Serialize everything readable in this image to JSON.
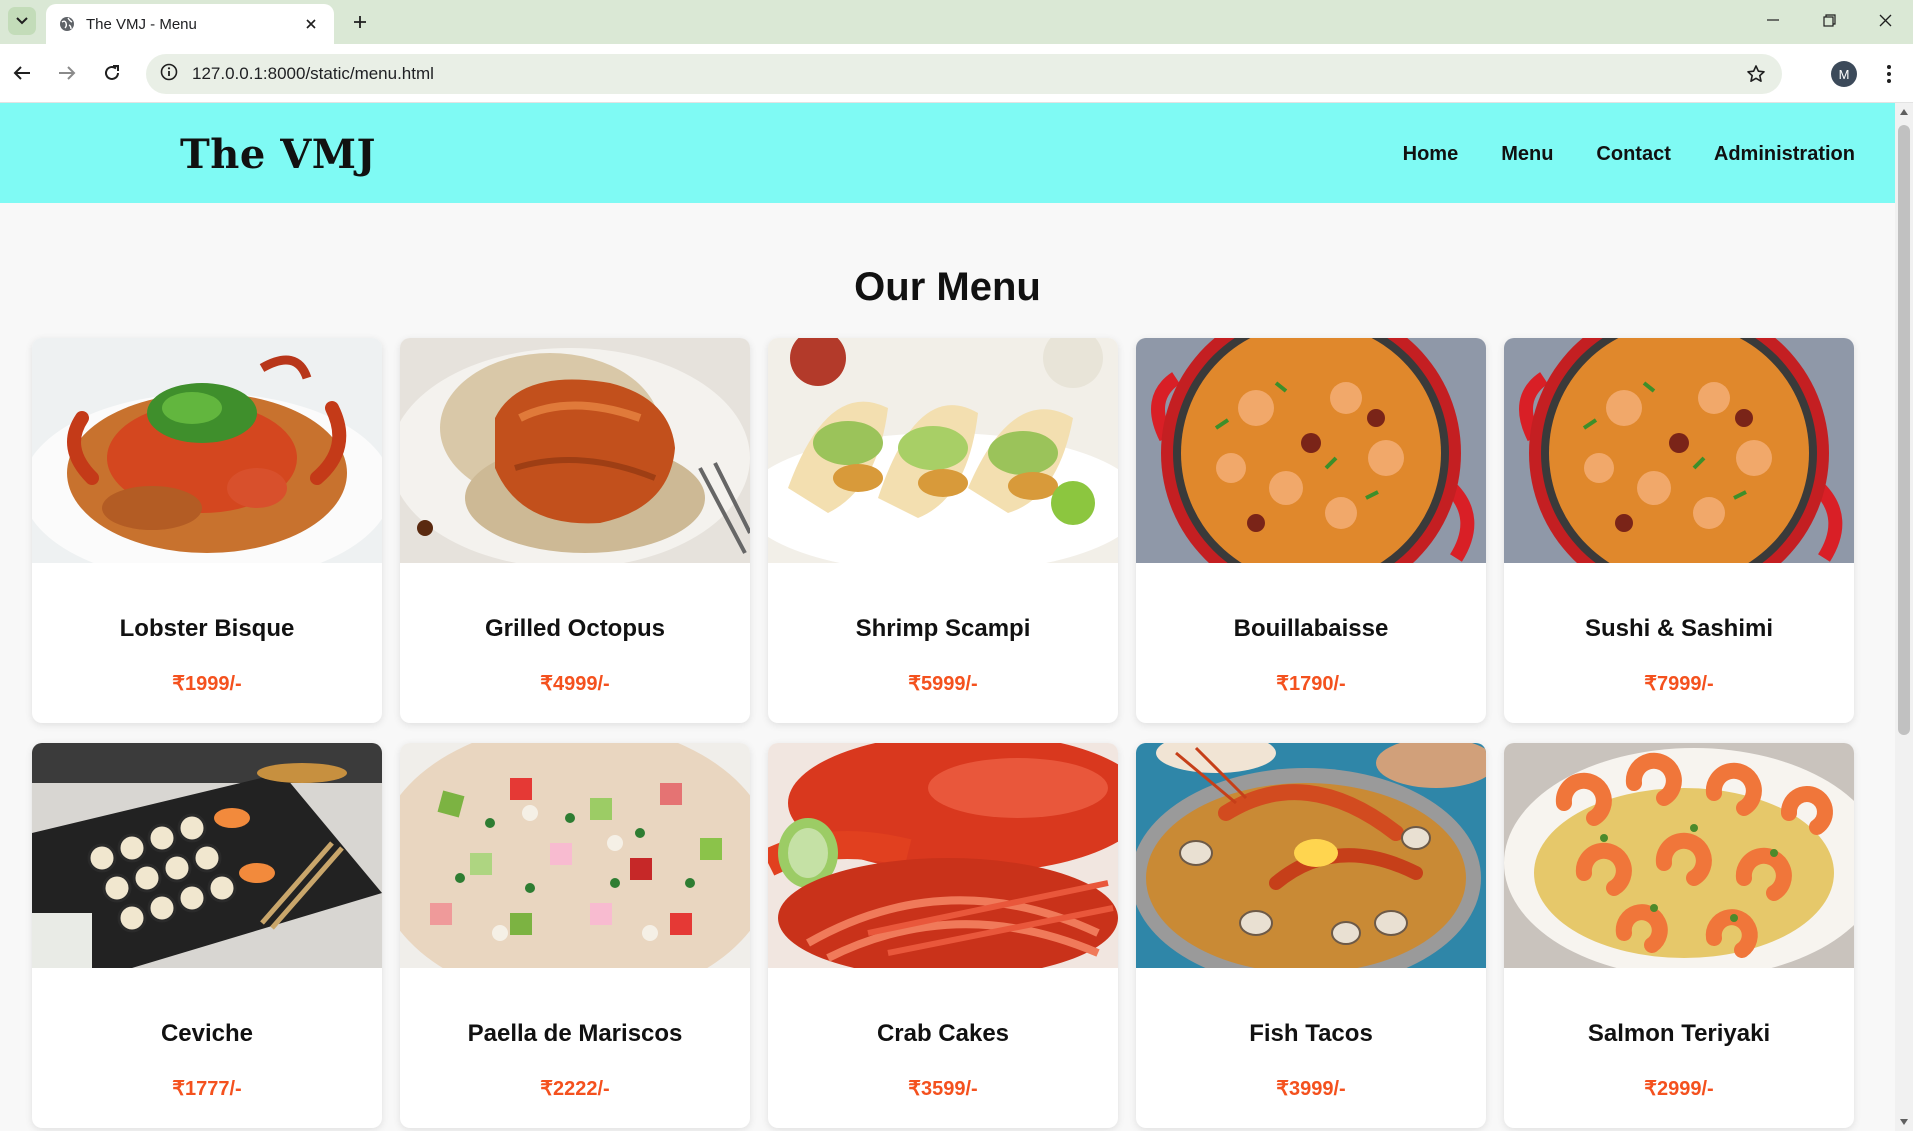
{
  "browser": {
    "tab_title": "The VMJ - Menu",
    "url": "127.0.0.1:8000/static/menu.html",
    "profile_initial": "M"
  },
  "site": {
    "logo": "The VMJ",
    "nav": [
      "Home",
      "Menu",
      "Contact",
      "Administration"
    ],
    "heading": "Our Menu"
  },
  "menu_items": [
    {
      "name": "Lobster Bisque",
      "price": "₹1999/-",
      "image": "crab-dish-photo"
    },
    {
      "name": "Grilled Octopus",
      "price": "₹4999/-",
      "image": "glazed-salmon-photo"
    },
    {
      "name": "Shrimp Scampi",
      "price": "₹5999/-",
      "image": "fish-tacos-photo"
    },
    {
      "name": "Bouillabaisse",
      "price": "₹1790/-",
      "image": "shrimp-paella-pan-photo"
    },
    {
      "name": "Sushi & Sashimi",
      "price": "₹7999/-",
      "image": "shrimp-paella-pan-photo"
    },
    {
      "name": "Ceviche",
      "price": "₹1777/-",
      "image": "sushi-platter-photo"
    },
    {
      "name": "Paella de Mariscos",
      "price": "₹2222/-",
      "image": "ceviche-bowl-photo"
    },
    {
      "name": "Crab Cakes",
      "price": "₹3599/-",
      "image": "lobster-photo"
    },
    {
      "name": "Fish Tacos",
      "price": "₹3999/-",
      "image": "seafood-paella-photo"
    },
    {
      "name": "Salmon Teriyaki",
      "price": "₹2999/-",
      "image": "garlic-shrimp-photo"
    }
  ],
  "colors": {
    "header_bg": "#7ffaf4",
    "price": "#f4511e",
    "page_bg": "#f8f8f8"
  }
}
